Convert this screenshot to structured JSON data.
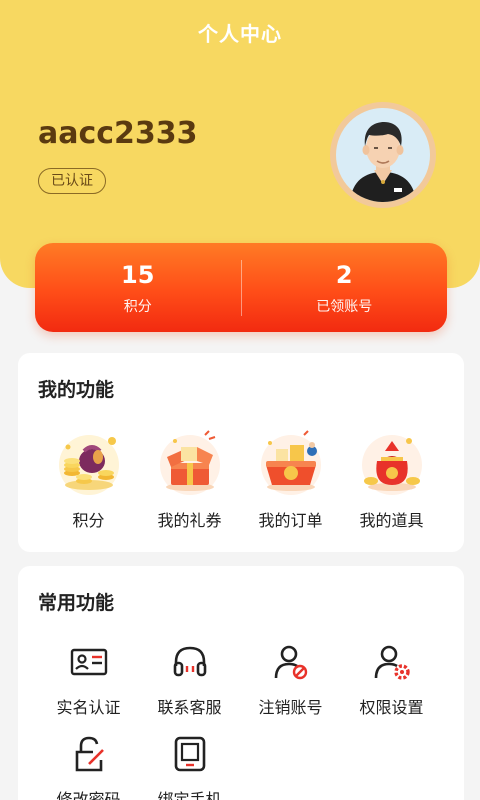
{
  "header": {
    "title": "个人中心"
  },
  "profile": {
    "username": "aacc2333",
    "verified_label": "已认证"
  },
  "stats": [
    {
      "value": "15",
      "label": "积分"
    },
    {
      "value": "2",
      "label": "已领账号"
    }
  ],
  "my_features": {
    "title": "我的功能",
    "items": [
      {
        "label": "积分",
        "icon": "coins-bag-icon"
      },
      {
        "label": "我的礼券",
        "icon": "gift-box-icon"
      },
      {
        "label": "我的订单",
        "icon": "order-basket-icon"
      },
      {
        "label": "我的道具",
        "icon": "lucky-bag-icon"
      }
    ]
  },
  "common_features": {
    "title": "常用功能",
    "items": [
      {
        "label": "实名认证",
        "icon": "id-card-icon"
      },
      {
        "label": "联系客服",
        "icon": "headset-icon"
      },
      {
        "label": "注销账号",
        "icon": "user-remove-icon"
      },
      {
        "label": "权限设置",
        "icon": "user-settings-icon"
      },
      {
        "label": "修改密码",
        "icon": "lock-edit-icon"
      },
      {
        "label": "绑定手机",
        "icon": "phone-icon"
      }
    ]
  },
  "colors": {
    "header_bg": "#f7d861",
    "accent": "#ff4d18",
    "icon_red": "#e8322a"
  }
}
